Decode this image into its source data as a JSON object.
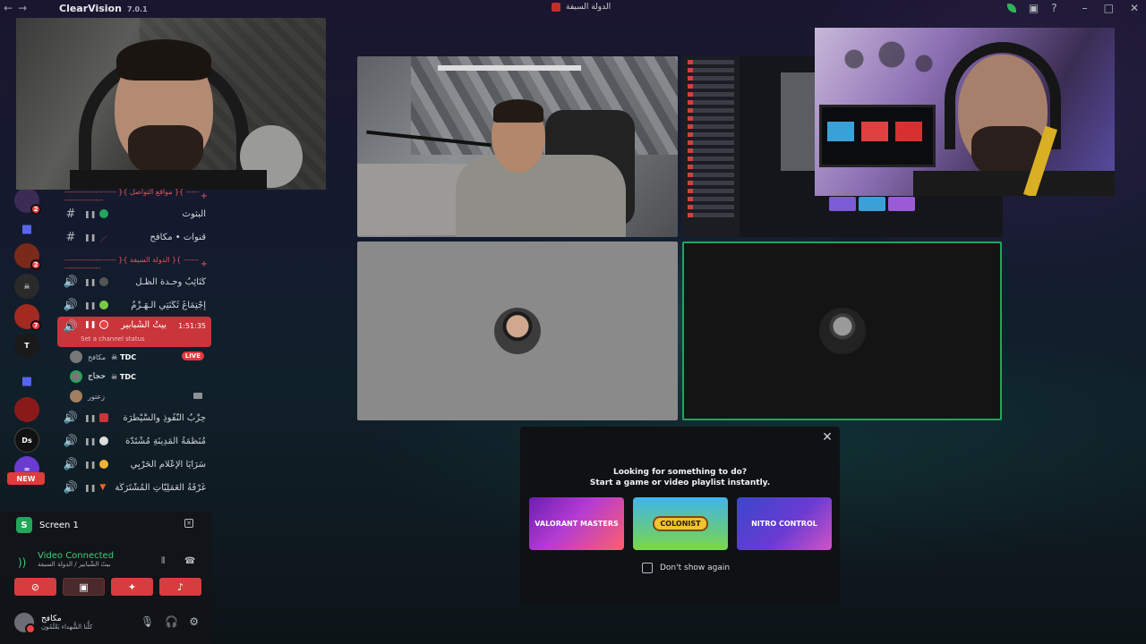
{
  "titlebar": {
    "app_name": "ClearVision",
    "app_version": "7.0.1",
    "server_title": "الدولة السيفة"
  },
  "servers": {
    "badges": [
      "2",
      "2",
      "7"
    ],
    "new_label": "NEW"
  },
  "channels": {
    "category_1": "-------------------- }{ مواقع التواصل }{ --------------------",
    "category_2": "-------------------- }{ الدولة السيفة }{ --------------------",
    "text": [
      {
        "name": "البثوث",
        "emoji_color": "#23a55a"
      },
      {
        "name": "قنوات • مكافح",
        "emoji_color": "#d83c3e"
      }
    ],
    "voice": [
      {
        "name": "كَتَائِبُ وحـدة الظـل"
      },
      {
        "name": "إِجْتِمَاعُ ثُكْنَتِي الـهَـزْمُ"
      }
    ],
    "active_voice": {
      "name": "بيتُ الشِّبابير",
      "time": "1:51:35",
      "status": "Set a channel status"
    },
    "members": [
      {
        "name": "مكافح",
        "tag": "TDC",
        "live": "LIVE"
      },
      {
        "name": "حجاج",
        "tag": "TDC"
      },
      {
        "name": "زعتور"
      }
    ],
    "voice_more": [
      {
        "name": "حِزْبُ النُّفُوذِ والسَّيْطَرَة"
      },
      {
        "name": "مُنَظَّمَةُ الْمَدِينَةِ مُشْتَدَّة"
      },
      {
        "name": "سَرَايَا الإِعْلَامِ الْحَرْبِي"
      },
      {
        "name": "غُرْفَةُ الْعَمَلِيَّاتِ الْمُشْتَرَكَة"
      }
    ]
  },
  "bottom": {
    "screen_label": "Screen 1",
    "video_connected": "Video Connected",
    "voice_channel_path": "بيتُ الشِّبابير / الدولة السيفة",
    "user_name": "مكافح",
    "user_status": "كلُّنا الشُّهداء يَعْلَمُون"
  },
  "popup": {
    "line1": "Looking for something to do?",
    "line2": "Start a game or video playlist instantly.",
    "cards": [
      {
        "label": "VALORANT MASTERS"
      },
      {
        "label": "COLONIST"
      },
      {
        "label": "NITRO CONTROL"
      }
    ],
    "dont_show": "Don't show again",
    "close_icon": "✕"
  }
}
